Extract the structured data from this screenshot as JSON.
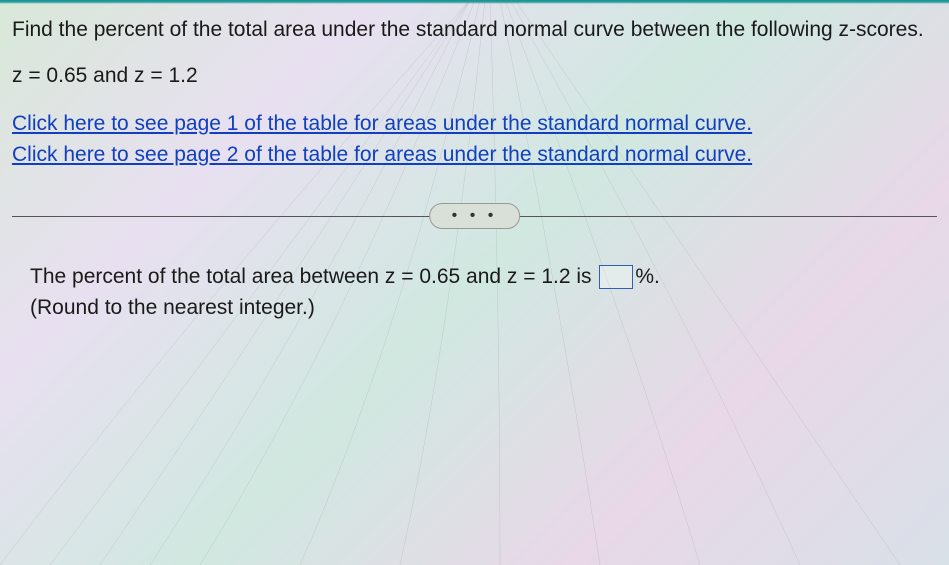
{
  "question": {
    "prompt": "Find the percent of the total area under the standard normal curve between the following z-scores.",
    "zvalues": "z = 0.65 and z = 1.2"
  },
  "links": {
    "page1": "Click here to see page 1 of the table for areas under the standard normal curve.",
    "page2": "Click here to see page 2 of the table for areas under the standard normal curve."
  },
  "divider": {
    "dots": "• • •"
  },
  "answer": {
    "prefix": "The percent of the total area between z = 0.65 and z = 1.2 is ",
    "suffix": "%.",
    "hint": "(Round to the nearest integer.)"
  }
}
